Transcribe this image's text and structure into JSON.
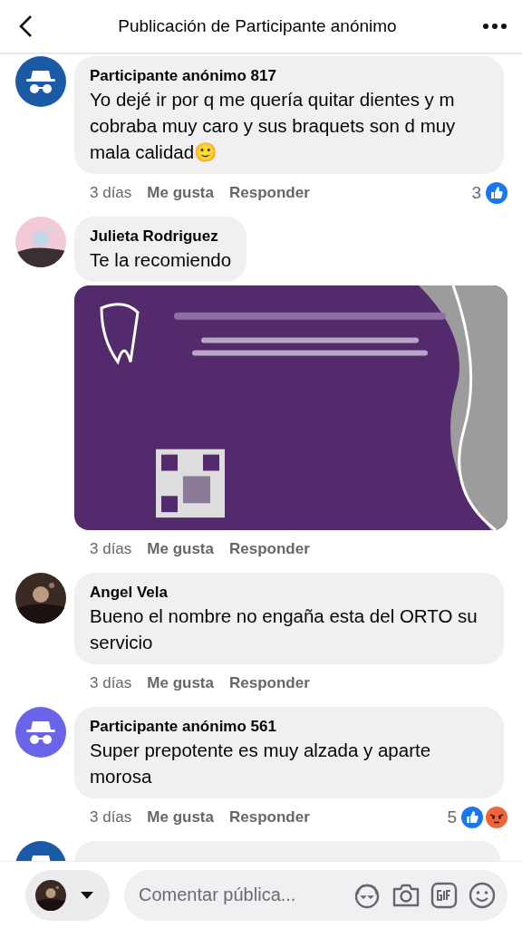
{
  "header": {
    "title": "Publicación de Participante anónimo"
  },
  "comments": [
    {
      "author": "Participante anónimo 817",
      "avatar": {
        "kind": "anonymous",
        "color": "#1b5aa6"
      },
      "text": "Yo dejé ir por q me quería quitar dientes y m cobraba muy caro y sus braquets son d muy mala calidad🙂",
      "time": "3 días",
      "like": "Me gusta",
      "reply": "Responder",
      "reaction_count": "3",
      "reactions": [
        {
          "kind": "like"
        }
      ]
    },
    {
      "author": "Julieta Rodriguez",
      "text": "Te la recomiendo",
      "time": "3 días",
      "like": "Me gusta",
      "reply": "Responder"
    },
    {
      "author": "Angel Vela",
      "text": "Bueno el nombre no engaña esta del ORTO su servicio",
      "time": "3 días",
      "like": "Me gusta",
      "reply": "Responder"
    },
    {
      "author": "Participante anónimo 561",
      "avatar": {
        "kind": "anonymous",
        "color": "#6a64e8"
      },
      "text": "Super prepotente es muy alzada y aparte morosa",
      "time": "3 días",
      "like": "Me gusta",
      "reply": "Responder",
      "reaction_count": "5",
      "reactions": [
        {
          "kind": "like"
        },
        {
          "kind": "angry"
        }
      ]
    },
    {
      "avatar": {
        "kind": "anonymous",
        "color": "#1b5aa6"
      }
    }
  ],
  "composer": {
    "placeholder": "Comentar pública..."
  }
}
